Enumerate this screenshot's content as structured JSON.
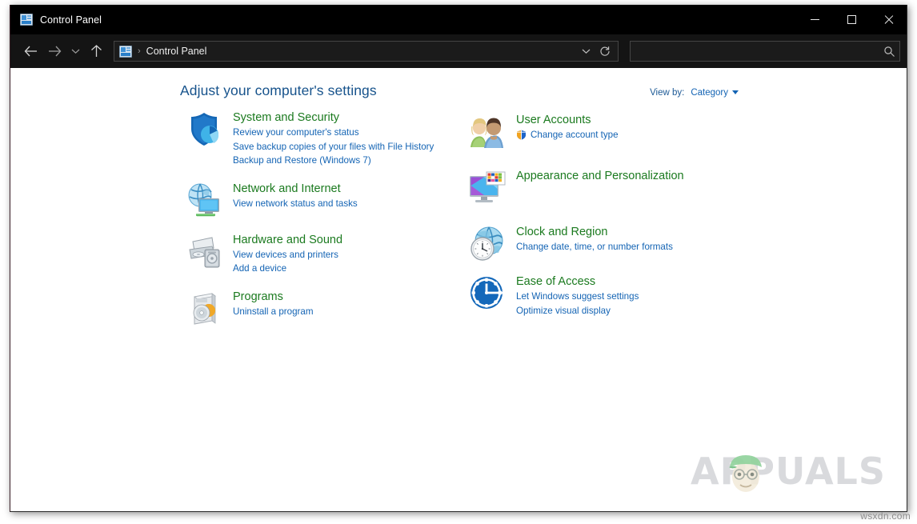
{
  "window": {
    "title": "Control Panel",
    "title_icon": "control-panel-icon",
    "controls": {
      "minimize": "—",
      "maximize": "□",
      "close": "✕"
    }
  },
  "navbar": {
    "back_icon": "arrow-left-icon",
    "forward_icon": "arrow-right-icon",
    "recent_icon": "chevron-down-icon",
    "up_icon": "arrow-up-icon",
    "address": {
      "icon": "control-panel-icon",
      "separator": "›",
      "crumb": "Control Panel",
      "dropdown_icon": "chevron-down-icon",
      "refresh_icon": "refresh-icon"
    },
    "search": {
      "value": "",
      "placeholder": "",
      "icon": "search-icon"
    }
  },
  "main": {
    "page_title": "Adjust your computer's settings",
    "view_by": {
      "label": "View by:",
      "value": "Category",
      "caret_icon": "caret-down-icon"
    },
    "left_column": [
      {
        "icon": "shield-security-icon",
        "title": "System and Security",
        "links": [
          {
            "text": "Review your computer's status",
            "shield": false
          },
          {
            "text": "Save backup copies of your files with File History",
            "shield": false
          },
          {
            "text": "Backup and Restore (Windows 7)",
            "shield": false
          }
        ]
      },
      {
        "icon": "network-globe-monitor-icon",
        "title": "Network and Internet",
        "links": [
          {
            "text": "View network status and tasks",
            "shield": false
          }
        ]
      },
      {
        "icon": "printer-speaker-icon",
        "title": "Hardware and Sound",
        "links": [
          {
            "text": "View devices and printers",
            "shield": false
          },
          {
            "text": "Add a device",
            "shield": false
          }
        ]
      },
      {
        "icon": "programs-disc-icon",
        "title": "Programs",
        "links": [
          {
            "text": "Uninstall a program",
            "shield": false
          }
        ]
      }
    ],
    "right_column": [
      {
        "icon": "user-accounts-people-icon",
        "title": "User Accounts",
        "links": [
          {
            "text": "Change account type",
            "shield": true
          }
        ]
      },
      {
        "icon": "appearance-monitor-palette-icon",
        "title": "Appearance and Personalization",
        "links": []
      },
      {
        "icon": "clock-globe-icon",
        "title": "Clock and Region",
        "links": [
          {
            "text": "Change date, time, or number formats",
            "shield": false
          }
        ]
      },
      {
        "icon": "ease-of-access-clock-icon",
        "title": "Ease of Access",
        "links": [
          {
            "text": "Let Windows suggest settings",
            "shield": false
          },
          {
            "text": "Optimize visual display",
            "shield": false
          }
        ]
      }
    ]
  },
  "watermark": {
    "text": "APPUALS",
    "mascot_icon": "appuals-mascot-icon"
  },
  "site_tag": "wsxdn.com",
  "colors": {
    "category_title": "#1b7a1f",
    "link": "#1464b4",
    "page_title": "#17538c",
    "titlebar_bg": "#000000",
    "navbar_bg": "#141414",
    "content_bg": "#ffffff"
  }
}
